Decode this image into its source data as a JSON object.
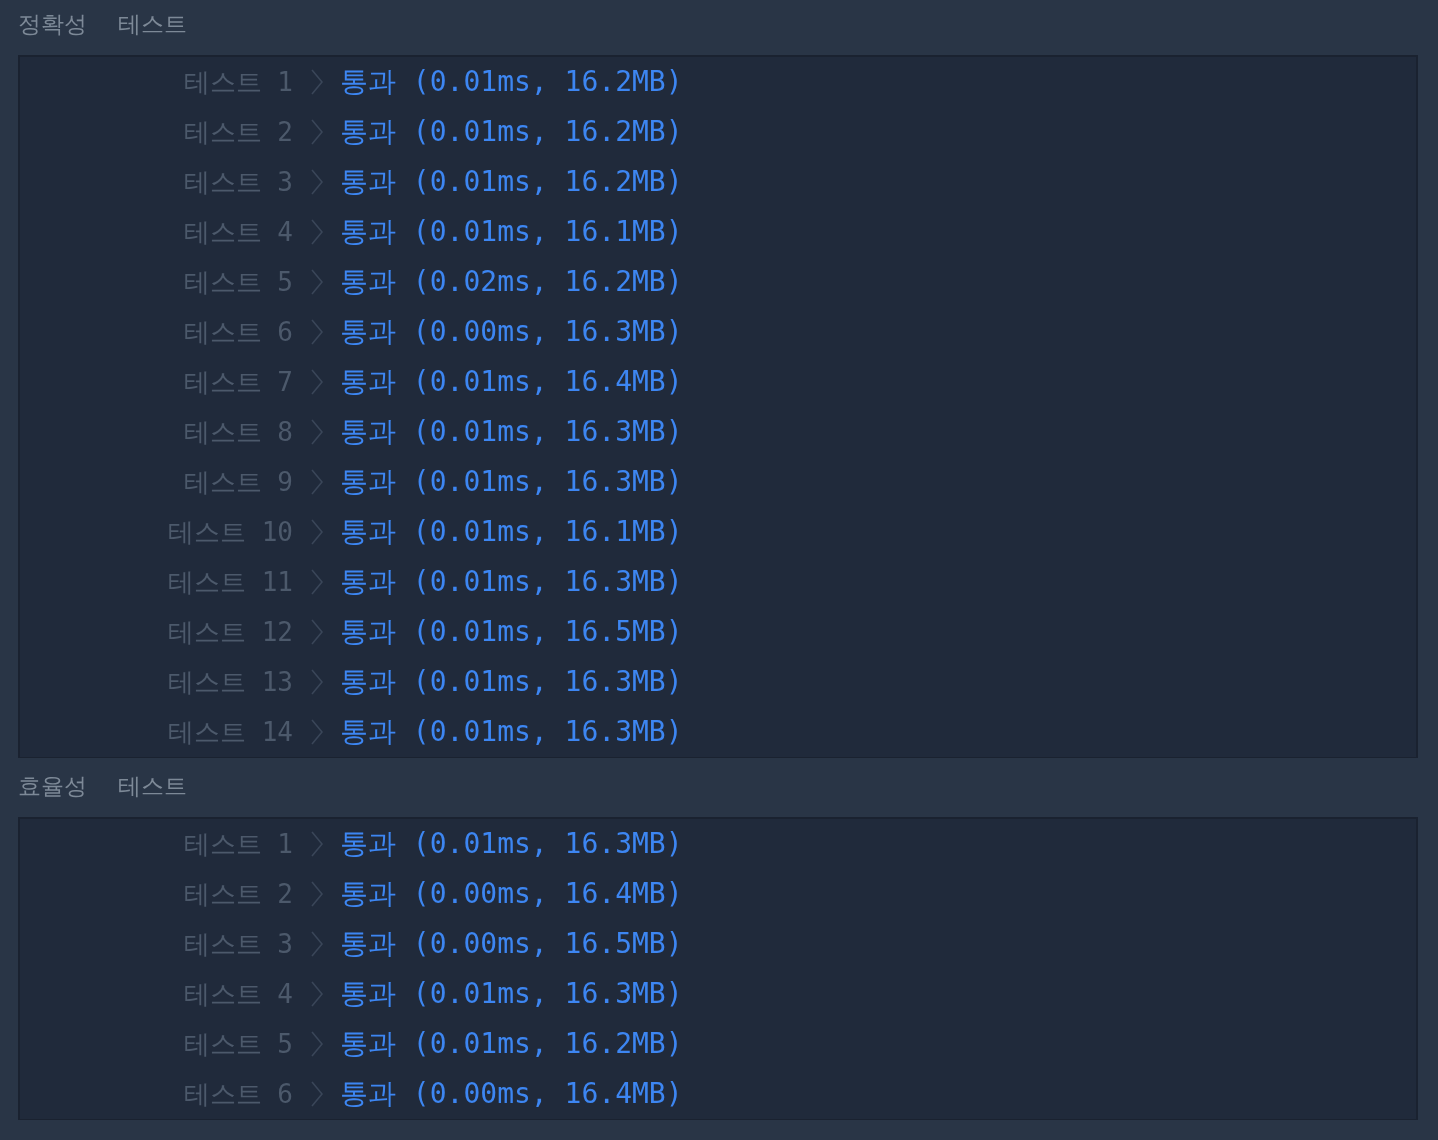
{
  "sections": [
    {
      "title": "정확성 테스트",
      "tests": [
        {
          "label": "테스트 1",
          "result": "통과 (0.01ms, 16.2MB)"
        },
        {
          "label": "테스트 2",
          "result": "통과 (0.01ms, 16.2MB)"
        },
        {
          "label": "테스트 3",
          "result": "통과 (0.01ms, 16.2MB)"
        },
        {
          "label": "테스트 4",
          "result": "통과 (0.01ms, 16.1MB)"
        },
        {
          "label": "테스트 5",
          "result": "통과 (0.02ms, 16.2MB)"
        },
        {
          "label": "테스트 6",
          "result": "통과 (0.00ms, 16.3MB)"
        },
        {
          "label": "테스트 7",
          "result": "통과 (0.01ms, 16.4MB)"
        },
        {
          "label": "테스트 8",
          "result": "통과 (0.01ms, 16.3MB)"
        },
        {
          "label": "테스트 9",
          "result": "통과 (0.01ms, 16.3MB)"
        },
        {
          "label": "테스트 10",
          "result": "통과 (0.01ms, 16.1MB)"
        },
        {
          "label": "테스트 11",
          "result": "통과 (0.01ms, 16.3MB)"
        },
        {
          "label": "테스트 12",
          "result": "통과 (0.01ms, 16.5MB)"
        },
        {
          "label": "테스트 13",
          "result": "통과 (0.01ms, 16.3MB)"
        },
        {
          "label": "테스트 14",
          "result": "통과 (0.01ms, 16.3MB)"
        }
      ]
    },
    {
      "title": "효율성 테스트",
      "tests": [
        {
          "label": "테스트 1",
          "result": "통과 (0.01ms, 16.3MB)"
        },
        {
          "label": "테스트 2",
          "result": "통과 (0.00ms, 16.4MB)"
        },
        {
          "label": "테스트 3",
          "result": "통과 (0.00ms, 16.5MB)"
        },
        {
          "label": "테스트 4",
          "result": "통과 (0.01ms, 16.3MB)"
        },
        {
          "label": "테스트 5",
          "result": "통과 (0.01ms, 16.2MB)"
        },
        {
          "label": "테스트 6",
          "result": "통과 (0.00ms, 16.4MB)"
        }
      ]
    }
  ]
}
